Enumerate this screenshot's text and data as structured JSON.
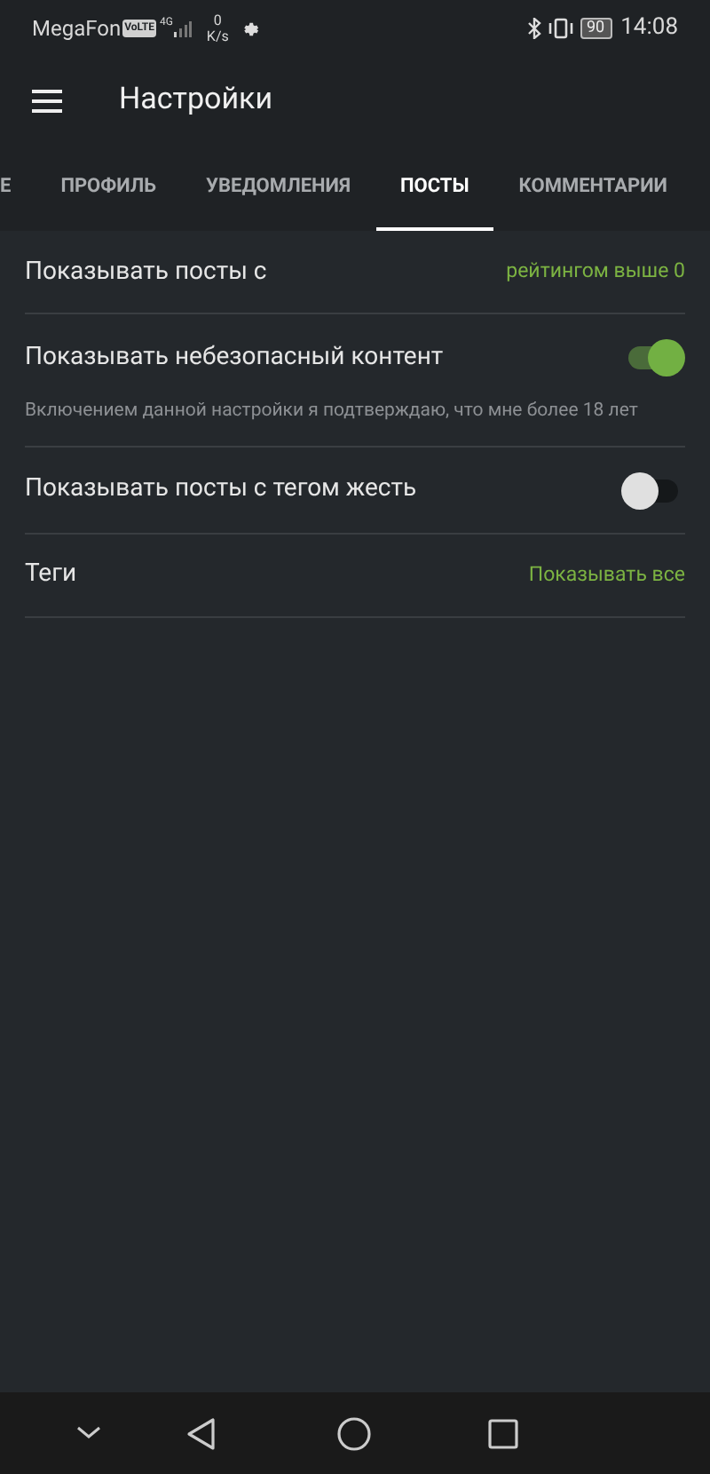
{
  "status_bar": {
    "carrier": "MegaFon",
    "volte": "VoLTE",
    "network": "4G",
    "speed_value": "0",
    "speed_unit": "K/s",
    "battery": "90",
    "time": "14:08"
  },
  "app_bar": {
    "title": "Настройки"
  },
  "tabs": [
    {
      "label": "Е",
      "selected": false
    },
    {
      "label": "ПРОФИЛЬ",
      "selected": false
    },
    {
      "label": "УВЕДОМЛЕНИЯ",
      "selected": false
    },
    {
      "label": "ПОСТЫ",
      "selected": true
    },
    {
      "label": "КОММЕНТАРИИ",
      "selected": false
    }
  ],
  "settings": [
    {
      "kind": "value",
      "label": "Показывать посты с",
      "value": "рейтингом выше 0"
    },
    {
      "kind": "toggle",
      "label": "Показывать небезопасный контент",
      "on": true,
      "note": "Включением данной настройки я подтверждаю, что мне более 18 лет"
    },
    {
      "kind": "toggle",
      "label": "Показывать посты с тегом жесть",
      "on": false
    },
    {
      "kind": "value",
      "label": "Теги",
      "value": "Показывать все"
    }
  ]
}
